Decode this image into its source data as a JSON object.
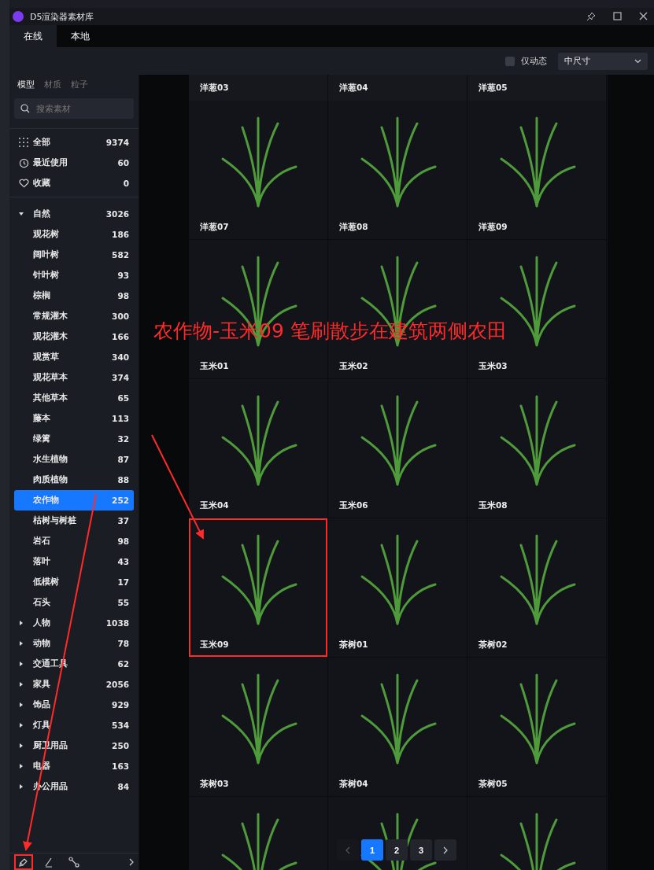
{
  "app": {
    "title": "D5渲染器素材库"
  },
  "tabs": [
    {
      "label": "在线",
      "selected": true
    },
    {
      "label": "本地",
      "selected": false
    }
  ],
  "filter": {
    "dynamic_only": {
      "label": "仅动态",
      "checked": false
    },
    "size_select": {
      "value": "中尺寸"
    }
  },
  "sidebar": {
    "type_tabs": [
      {
        "label": "模型",
        "selected": true
      },
      {
        "label": "材质",
        "selected": false
      },
      {
        "label": "粒子",
        "selected": false
      }
    ],
    "search": {
      "placeholder": "搜索素材"
    },
    "quick": [
      {
        "kind": "all",
        "label": "全部",
        "count": "9374",
        "selected": false
      },
      {
        "kind": "recent",
        "label": "最近使用",
        "count": "60",
        "selected": false
      },
      {
        "kind": "favorite",
        "label": "收藏",
        "count": "0",
        "selected": false
      }
    ],
    "tree": [
      {
        "label": "自然",
        "count": "3026",
        "expanded": true,
        "selected": false,
        "children": [
          {
            "label": "观花树",
            "count": "186",
            "selected": false
          },
          {
            "label": "阔叶树",
            "count": "582",
            "selected": false
          },
          {
            "label": "针叶树",
            "count": "93",
            "selected": false
          },
          {
            "label": "棕榈",
            "count": "98",
            "selected": false
          },
          {
            "label": "常规灌木",
            "count": "300",
            "selected": false
          },
          {
            "label": "观花灌木",
            "count": "166",
            "selected": false
          },
          {
            "label": "观赏草",
            "count": "340",
            "selected": false
          },
          {
            "label": "观花草本",
            "count": "374",
            "selected": false
          },
          {
            "label": "其他草本",
            "count": "65",
            "selected": false
          },
          {
            "label": "藤本",
            "count": "113",
            "selected": false
          },
          {
            "label": "绿篱",
            "count": "32",
            "selected": false
          },
          {
            "label": "水生植物",
            "count": "87",
            "selected": false
          },
          {
            "label": "肉质植物",
            "count": "88",
            "selected": false
          },
          {
            "label": "农作物",
            "count": "252",
            "selected": true
          },
          {
            "label": "枯树与树桩",
            "count": "37",
            "selected": false
          },
          {
            "label": "岩石",
            "count": "98",
            "selected": false
          },
          {
            "label": "落叶",
            "count": "43",
            "selected": false
          },
          {
            "label": "低模树",
            "count": "17",
            "selected": false
          },
          {
            "label": "石头",
            "count": "55",
            "selected": false
          }
        ]
      },
      {
        "label": "人物",
        "count": "1038",
        "expanded": false,
        "selected": false
      },
      {
        "label": "动物",
        "count": "78",
        "expanded": false,
        "selected": false
      },
      {
        "label": "交通工具",
        "count": "62",
        "expanded": false,
        "selected": false
      },
      {
        "label": "家具",
        "count": "2056",
        "expanded": false,
        "selected": false
      },
      {
        "label": "饰品",
        "count": "929",
        "expanded": false,
        "selected": false
      },
      {
        "label": "灯具",
        "count": "534",
        "expanded": false,
        "selected": false
      },
      {
        "label": "厨卫用品",
        "count": "250",
        "expanded": false,
        "selected": false
      },
      {
        "label": "电器",
        "count": "163",
        "expanded": false,
        "selected": false
      },
      {
        "label": "办公用品",
        "count": "84",
        "expanded": false,
        "selected": false
      }
    ],
    "toolbar": [
      {
        "kind": "brush",
        "highlighted": true
      },
      {
        "kind": "pen",
        "highlighted": false
      },
      {
        "kind": "path",
        "highlighted": false
      }
    ]
  },
  "grid": {
    "header_labels": [
      "洋葱03",
      "洋葱04",
      "洋葱05"
    ],
    "cards": [
      {
        "label": "洋葱07",
        "highlighted": false
      },
      {
        "label": "洋葱08",
        "highlighted": false
      },
      {
        "label": "洋葱09",
        "highlighted": false
      },
      {
        "label": "玉米01",
        "highlighted": false
      },
      {
        "label": "玉米02",
        "highlighted": false
      },
      {
        "label": "玉米03",
        "highlighted": false
      },
      {
        "label": "玉米04",
        "highlighted": false
      },
      {
        "label": "玉米06",
        "highlighted": false
      },
      {
        "label": "玉米08",
        "highlighted": false
      },
      {
        "label": "玉米09",
        "highlighted": true
      },
      {
        "label": "茶树01",
        "highlighted": false
      },
      {
        "label": "茶树02",
        "highlighted": false
      },
      {
        "label": "茶树03",
        "highlighted": false
      },
      {
        "label": "茶树04",
        "highlighted": false
      },
      {
        "label": "茶树05",
        "highlighted": false
      }
    ]
  },
  "pagination": {
    "pages": [
      {
        "label": "1",
        "selected": true
      },
      {
        "label": "2",
        "selected": false
      },
      {
        "label": "3",
        "selected": false
      }
    ]
  },
  "annotation": {
    "text": "农作物-玉米09 笔刷散步在建筑两侧农田"
  }
}
